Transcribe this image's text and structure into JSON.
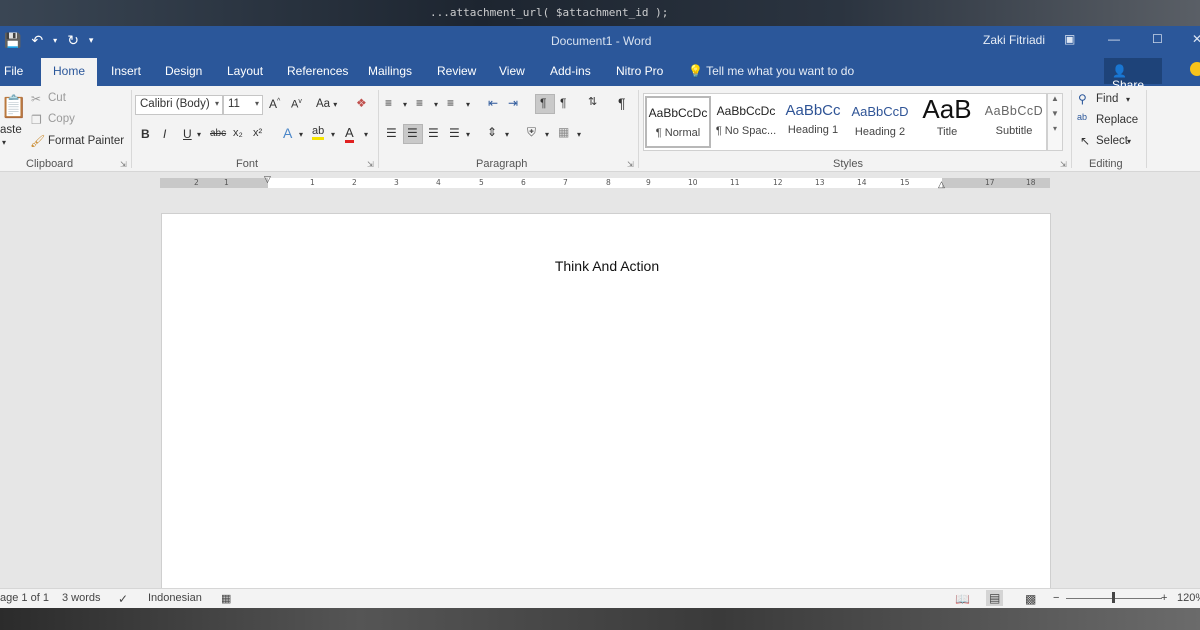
{
  "background": {
    "code_snippet": "...attachment_url( $attachment_id );"
  },
  "titlebar": {
    "document_title": "Document1 - Word",
    "user_name": "Zaki Fitriadi"
  },
  "tabs": {
    "file": "File",
    "items": [
      "Home",
      "Insert",
      "Design",
      "Layout",
      "References",
      "Mailings",
      "Review",
      "View",
      "Add-ins",
      "Nitro Pro"
    ],
    "active": "Home",
    "tell_me": "Tell me what you want to do",
    "share": "Share"
  },
  "ribbon": {
    "clipboard": {
      "paste": "aste",
      "cut": "Cut",
      "copy": "Copy",
      "format_painter": "Format Painter",
      "label": "Clipboard"
    },
    "font": {
      "font_name": "Calibri (Body)",
      "font_size": "11",
      "change_case": "Aa",
      "label": "Font",
      "bold": "B",
      "italic": "I",
      "underline": "U",
      "strikethrough": "abc",
      "subscript": "x₂",
      "superscript": "x²"
    },
    "paragraph": {
      "label": "Paragraph"
    },
    "styles": {
      "label": "Styles",
      "items": [
        {
          "preview": "AaBbCcDc",
          "name": "¶ Normal"
        },
        {
          "preview": "AaBbCcDc",
          "name": "¶ No Spac..."
        },
        {
          "preview": "AaBbCc",
          "name": "Heading 1"
        },
        {
          "preview": "AaBbCcD",
          "name": "Heading 2"
        },
        {
          "preview": "AaB",
          "name": "Title"
        },
        {
          "preview": "AaBbCcD",
          "name": "Subtitle"
        }
      ]
    },
    "editing": {
      "find": "Find",
      "replace": "Replace",
      "select": "Select",
      "label": "Editing"
    }
  },
  "ruler": {
    "ticks": [
      "2",
      "1",
      "1",
      "2",
      "3",
      "4",
      "5",
      "6",
      "7",
      "8",
      "9",
      "10",
      "11",
      "12",
      "13",
      "14",
      "15",
      "17",
      "18"
    ]
  },
  "document": {
    "text": "Think And Action"
  },
  "status": {
    "page": "age 1 of 1",
    "words": "3 words",
    "language": "Indonesian",
    "zoom": "120%"
  },
  "colors": {
    "accent": "#2b579a",
    "ribbon_bg": "#f3f3f3",
    "share_bg": "#1e4379"
  }
}
